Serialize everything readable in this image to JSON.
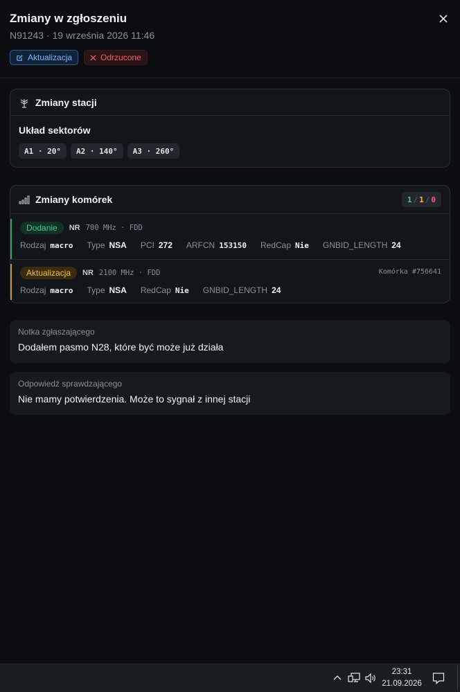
{
  "header": {
    "title": "Zmiany w zgłoszeniu",
    "subtitle": "N91243 · 19 września 2026 11:46",
    "badges": {
      "update": "Aktualizacja",
      "rejected": "Odrzucone"
    }
  },
  "station_changes": {
    "title": "Zmiany stacji",
    "section": "Układ sektorów",
    "sectors": [
      "A1 · 20°",
      "A2 · 140°",
      "A3 · 260°"
    ]
  },
  "cell_changes": {
    "title": "Zmiany komórek",
    "counts": {
      "added": "1",
      "updated": "1",
      "removed": "0"
    },
    "rows": [
      {
        "tag": "Dodanie",
        "tech": "NR",
        "freq": "700 MHz · FDD",
        "cell_id": "",
        "attrs": [
          {
            "k": "Rodzaj",
            "v": "macro"
          },
          {
            "k": "Type",
            "v": "NSA"
          },
          {
            "k": "PCI",
            "v": "272"
          },
          {
            "k": "ARFCN",
            "v": "153150"
          },
          {
            "k": "RedCap",
            "v": "Nie"
          },
          {
            "k": "GNBID_LENGTH",
            "v": "24"
          }
        ]
      },
      {
        "tag": "Aktualizacja",
        "tech": "NR",
        "freq": "2100 MHz · FDD",
        "cell_id": "Komórka #756641",
        "attrs": [
          {
            "k": "Rodzaj",
            "v": "macro"
          },
          {
            "k": "Type",
            "v": "NSA"
          },
          {
            "k": "RedCap",
            "v": "Nie"
          },
          {
            "k": "GNBID_LENGTH",
            "v": "24"
          }
        ]
      }
    ]
  },
  "notes": {
    "submitter_label": "Notka zgłaszającego",
    "submitter_text": "Dodałem pasmo N28, które być może już działa",
    "reviewer_label": "Odpowiedź sprawdzającego",
    "reviewer_text": "Nie mamy potwierdzenia. Może to sygnał z innej stacji"
  },
  "taskbar": {
    "time": "23:31",
    "date": "21.09.2026"
  },
  "icons": [
    "close-icon",
    "edit-icon",
    "x-icon",
    "antenna-icon",
    "signal-bars-icon",
    "chevron-up-icon",
    "network-icon",
    "volume-icon",
    "notification-icon"
  ]
}
